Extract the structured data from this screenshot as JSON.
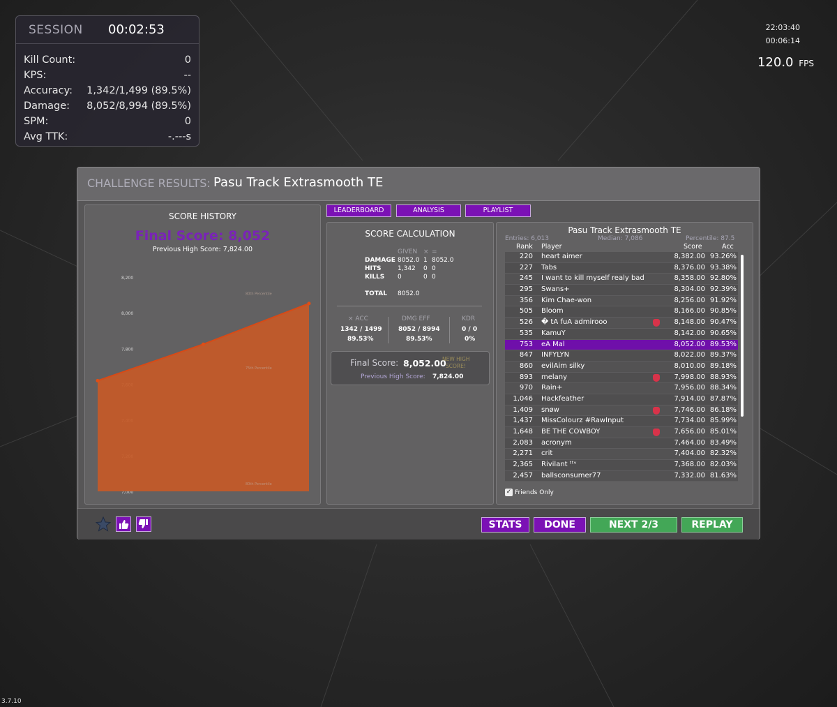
{
  "session": {
    "title": "SESSION",
    "time": "00:02:53",
    "stats": [
      {
        "label": "Kill Count:",
        "value": "0"
      },
      {
        "label": "KPS:",
        "value": "--"
      },
      {
        "label": "Accuracy:",
        "value": "1,342/1,499 (89.5%)"
      },
      {
        "label": "Damage:",
        "value": "8,052/8,994 (89.5%)"
      },
      {
        "label": "SPM:",
        "value": "0"
      },
      {
        "label": "Avg TTK:",
        "value": "-.---s"
      }
    ]
  },
  "clock": {
    "time": "22:03:40",
    "elapsed": "00:06:14",
    "fps": "120.0",
    "fps_unit": "FPS"
  },
  "version": "3.7.10",
  "dialog": {
    "label": "CHALLENGE RESULTS:",
    "name": "Pasu Track Extrasmooth TE"
  },
  "tabs": {
    "leaderboard": "LEADERBOARD",
    "analysis": "ANALYSIS",
    "playlist": "PLAYLIST"
  },
  "history": {
    "title": "SCORE HISTORY",
    "final_score": "Final Score: 8,052",
    "previous": "Previous High Score: 7,824.00",
    "y_ticks": [
      "8,200",
      "8,000",
      "7,800",
      "7,600",
      "7,400",
      "7,200",
      "7,000"
    ],
    "percentile_labels": [
      "80th Percentile",
      "75th Percentile",
      "80th Percentile"
    ]
  },
  "chart_data": {
    "type": "area",
    "title": "SCORE HISTORY",
    "x": [
      1,
      2,
      3
    ],
    "values": [
      7620,
      7824,
      8052
    ],
    "ylim": [
      7000,
      8200
    ],
    "color": "#c55a27"
  },
  "calc": {
    "title": "SCORE CALCULATION",
    "col_given": "GIVEN",
    "col_x": "×",
    "col_eq": "=",
    "rows": [
      {
        "label": "DAMAGE",
        "given": "8052.0",
        "mult": "1",
        "result": "8052.0"
      },
      {
        "label": "HITS",
        "given": "1,342",
        "mult": "0",
        "result": "0"
      },
      {
        "label": "KILLS",
        "given": "0",
        "mult": "0",
        "result": "0"
      }
    ],
    "total_label": "TOTAL",
    "total_value": "8052.0",
    "acc_label": "× ACC",
    "acc_ratio": "1342 / 1499",
    "acc_pct": "89.53%",
    "dmg_label": "DMG EFF",
    "dmg_ratio": "8052 / 8994",
    "dmg_pct": "89.53%",
    "kdr_label": "KDR",
    "kdr_ratio": "0 / 0",
    "kdr_pct": "0%",
    "final_label": "Final Score:",
    "final_value": "8,052.00",
    "new_high_1": "NEW HIGH",
    "new_high_2": "SCORE!",
    "prev_label": "Previous High Score:",
    "prev_value": "7,824.00"
  },
  "leaderboard": {
    "title": "Pasu Track Extrasmooth TE",
    "entries": "Entries: 6,013",
    "median": "Median: 7,086",
    "percentile": "Percentile: 87.5",
    "headers": {
      "rank": "Rank",
      "player": "Player",
      "score": "Score",
      "acc": "Acc"
    },
    "rows": [
      {
        "rank": "220",
        "player": "heart aimer",
        "score": "8,382.00",
        "acc": "93.26%",
        "badge": false
      },
      {
        "rank": "227",
        "player": "Tabs",
        "score": "8,376.00",
        "acc": "93.38%",
        "badge": false
      },
      {
        "rank": "245",
        "player": "I want to kill myself realy bad",
        "score": "8,358.00",
        "acc": "92.80%",
        "badge": false
      },
      {
        "rank": "295",
        "player": "Swans+",
        "score": "8,304.00",
        "acc": "92.39%",
        "badge": false
      },
      {
        "rank": "356",
        "player": "Kim Chae-won",
        "score": "8,256.00",
        "acc": "91.92%",
        "badge": false
      },
      {
        "rank": "505",
        "player": "Bloom",
        "score": "8,166.00",
        "acc": "90.85%",
        "badge": false
      },
      {
        "rank": "526",
        "player": "� tA fuA admirooo",
        "score": "8,148.00",
        "acc": "90.47%",
        "badge": true
      },
      {
        "rank": "535",
        "player": "KamuY",
        "score": "8,142.00",
        "acc": "90.65%",
        "badge": false
      },
      {
        "rank": "753",
        "player": "eA Mal",
        "score": "8,052.00",
        "acc": "89.53%",
        "badge": false,
        "me": true
      },
      {
        "rank": "847",
        "player": "INFYLYN",
        "score": "8,022.00",
        "acc": "89.37%",
        "badge": false
      },
      {
        "rank": "860",
        "player": "evilAim silky",
        "score": "8,010.00",
        "acc": "89.18%",
        "badge": false
      },
      {
        "rank": "893",
        "player": "melany",
        "score": "7,998.00",
        "acc": "88.93%",
        "badge": true
      },
      {
        "rank": "970",
        "player": "Rain+",
        "score": "7,956.00",
        "acc": "88.34%",
        "badge": false
      },
      {
        "rank": "1,046",
        "player": "Hackfeather",
        "score": "7,914.00",
        "acc": "87.87%",
        "badge": false
      },
      {
        "rank": "1,409",
        "player": "snøw",
        "score": "7,746.00",
        "acc": "86.18%",
        "badge": true
      },
      {
        "rank": "1,437",
        "player": "MissColourz #RawInput",
        "score": "7,734.00",
        "acc": "85.99%",
        "badge": false
      },
      {
        "rank": "1,648",
        "player": "BE THE COWBOY",
        "score": "7,656.00",
        "acc": "85.01%",
        "badge": true
      },
      {
        "rank": "2,083",
        "player": "acronym",
        "score": "7,464.00",
        "acc": "83.49%",
        "badge": false
      },
      {
        "rank": "2,271",
        "player": "crit",
        "score": "7,404.00",
        "acc": "82.32%",
        "badge": false
      },
      {
        "rank": "2,365",
        "player": "Rivilant ᵗᵗᵛ",
        "score": "7,368.00",
        "acc": "82.03%",
        "badge": false
      },
      {
        "rank": "2,457",
        "player": "ballsconsumer77",
        "score": "7,332.00",
        "acc": "81.63%",
        "badge": false
      }
    ],
    "friends_only": "Friends Only"
  },
  "footer": {
    "stats": "STATS",
    "done": "DONE",
    "next": "NEXT 2/3",
    "replay": "REPLAY"
  },
  "colors": {
    "accent": "#7b11b5",
    "green": "#43a757",
    "chart": "#c55a27",
    "final_score": "#7a23b8"
  }
}
